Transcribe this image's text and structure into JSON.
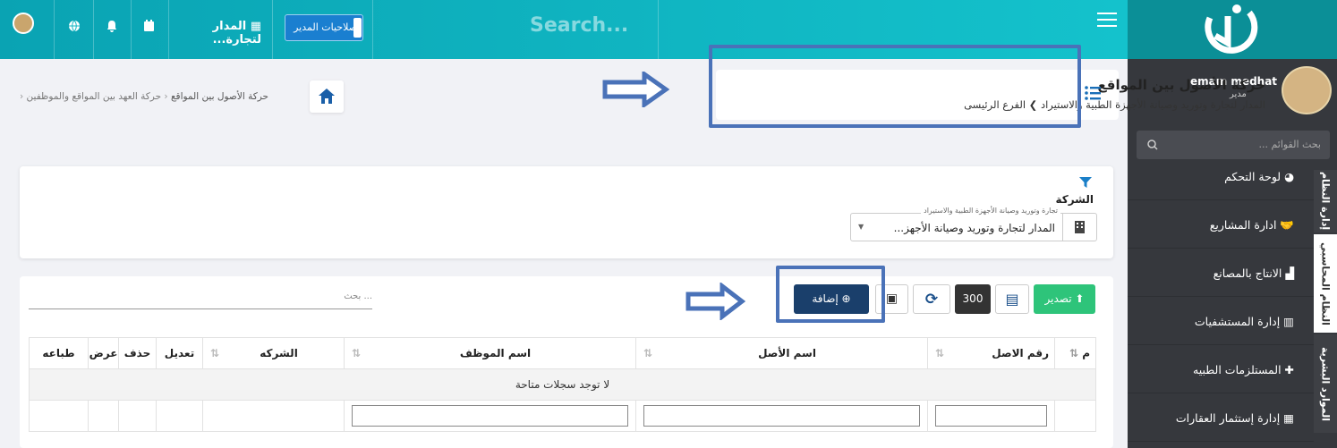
{
  "topbar": {
    "search_placeholder": "Search...",
    "company_label": "المدار لتجارة...",
    "manager_button": "صلاحيات المدير"
  },
  "page": {
    "title": "حركة الأصول بين المواقع",
    "subtitle": "المدار لتجارة وتوريد وصيانة الأجهزة الطبية والاستيراد",
    "branch": "الفرع الرئيسى"
  },
  "breadcrumb": {
    "item1": "حركة العهد بين المواقع والموظفين",
    "item2": "حركة الأصول بين المواقع"
  },
  "filter": {
    "section_label": "الشركة",
    "field_label": "تجارة وتوريد وصيانة الأجهزة الطبية والاستيراد",
    "value": "المدار لتجارة وتوريد وصيانة الأجهز..."
  },
  "toolbar": {
    "export": "تصدير",
    "count": "300",
    "add": "إضافة",
    "search_placeholder": "بحث ..."
  },
  "table": {
    "headers": [
      "م",
      "رقم الاصل",
      "اسم الأصل",
      "اسم الموظف",
      "الشركه",
      "تعديل",
      "حذف",
      "عرض",
      "طباعه"
    ],
    "empty_message": "لا توجد سجلات متاحة"
  },
  "sidebar": {
    "user_name": "emam medhat",
    "user_role": "مدير",
    "search_placeholder": "بحث القوائم ...",
    "items": [
      "لوحة التحكم",
      "ادارة المشاريع",
      "الانتاج بالمصانع",
      "إدارة المستشفيات",
      "المستلزمات الطبيه",
      "إدارة إستثمار العقارات"
    ],
    "tabs": [
      "إدارة النظام",
      "النظام المحاسبي",
      "الموارد البشرية"
    ]
  },
  "colors": {
    "topbar": "#14b8c4",
    "sidebar": "#36383d",
    "primary": "#1a3f6b",
    "success": "#2ec47a",
    "highlight": "#4a72b8"
  }
}
